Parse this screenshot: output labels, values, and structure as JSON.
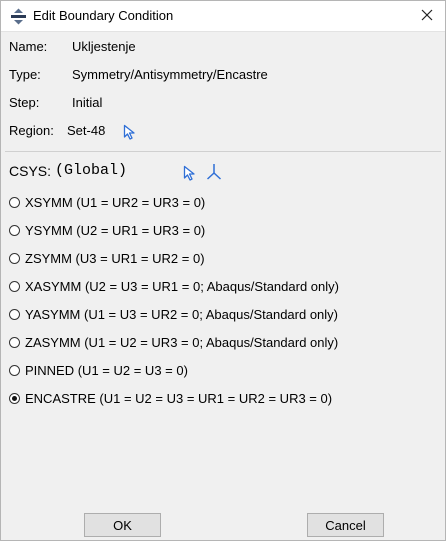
{
  "window": {
    "title": "Edit Boundary Condition",
    "icon": "boundary-condition-icon",
    "close_icon": "close-icon"
  },
  "fields": {
    "name_label": "Name:",
    "name_value": "Ukljestenje",
    "type_label": "Type:",
    "type_value": "Symmetry/Antisymmetry/Encastre",
    "step_label": "Step:",
    "step_value": "Initial",
    "region_label": "Region:",
    "region_value": "Set-48",
    "region_pick_icon": "arrow-pointer-icon"
  },
  "csys": {
    "label": "CSYS:",
    "value": "(Global)",
    "pick_icon": "arrow-pointer-icon",
    "axis_icon": "csys-axis-icon"
  },
  "options": [
    {
      "label": "XSYMM (U1 = UR2 = UR3 = 0)",
      "selected": false
    },
    {
      "label": "YSYMM (U2 = UR1 = UR3 = 0)",
      "selected": false
    },
    {
      "label": "ZSYMM (U3 = UR1 = UR2 = 0)",
      "selected": false
    },
    {
      "label": "XASYMM (U2 = U3 = UR1 = 0; Abaqus/Standard only)",
      "selected": false
    },
    {
      "label": "YASYMM (U1 = U3 = UR2 = 0; Abaqus/Standard only)",
      "selected": false
    },
    {
      "label": "ZASYMM (U1 = U2 = UR3 = 0; Abaqus/Standard only)",
      "selected": false
    },
    {
      "label": "PINNED (U1 = U2 = U3 = 0)",
      "selected": false
    },
    {
      "label": "ENCASTRE (U1 = U2 = U3 = UR1 = UR2 = UR3 = 0)",
      "selected": true
    }
  ],
  "buttons": {
    "ok": "OK",
    "cancel": "Cancel"
  },
  "colors": {
    "accent": "#3a7bd5",
    "dialog_bg": "#f0f0f0",
    "titlebar_bg": "#ffffff"
  }
}
